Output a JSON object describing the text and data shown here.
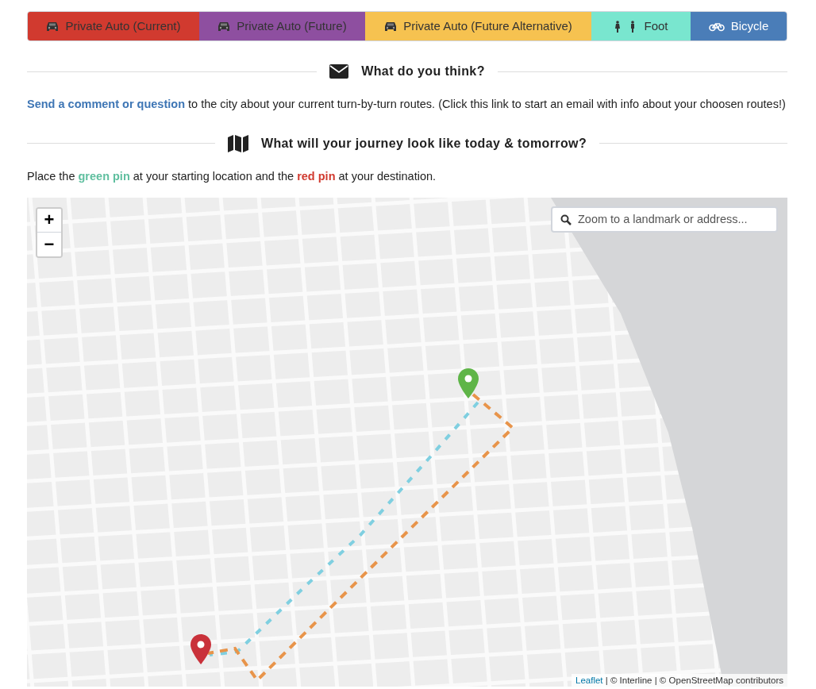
{
  "modes": [
    {
      "label": "Private Auto (Current)",
      "kind": "car",
      "color": "#d13a2f"
    },
    {
      "label": "Private Auto (Future)",
      "kind": "car",
      "color": "#8e4fa0"
    },
    {
      "label": "Private Auto (Future Alternative)",
      "kind": "car",
      "color": "#f6c250"
    },
    {
      "label": "Foot",
      "kind": "walk",
      "color": "#79e6cf"
    },
    {
      "label": "Bicycle",
      "kind": "bicycle",
      "color": "#4a7db8"
    }
  ],
  "feedback": {
    "heading": "What do you think?",
    "link": "Send a comment or question",
    "text": " to the city about your current turn-by-turn routes. (Click this link to start an email with info about your choosen routes!)"
  },
  "journey": {
    "heading": "What will your journey look like today & tomorrow?",
    "instruction": [
      {
        "text": "Place the "
      },
      {
        "text": "green pin",
        "color": "#5fbf9f"
      },
      {
        "text": " at your starting location and the "
      },
      {
        "text": "red pin",
        "color": "#d13a2f"
      },
      {
        "text": " at your destination."
      }
    ]
  },
  "map": {
    "zoom_in": "+",
    "zoom_out": "−",
    "search": {
      "placeholder": "Zoom to a landmark or address..."
    },
    "pins": [
      {
        "kind": "start",
        "color": "#5fb548"
      },
      {
        "kind": "end",
        "color": "#c9313a"
      }
    ],
    "attribution": {
      "link": "Leaflet",
      "text": " | © Interline | © OpenStreetMap contributors"
    }
  }
}
